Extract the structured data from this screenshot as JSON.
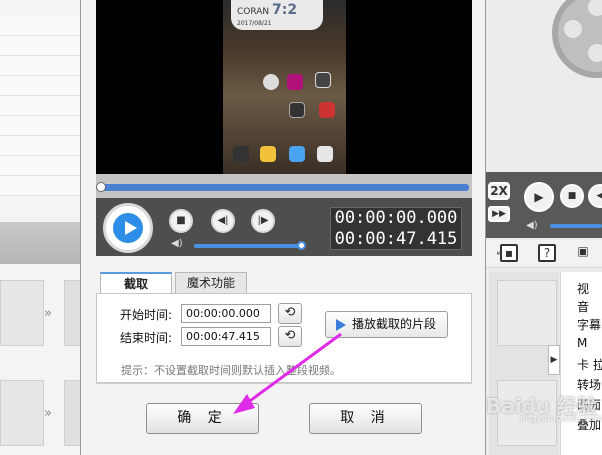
{
  "preview": {
    "phone_clock_brand": "CORAN",
    "phone_clock_time": "7:2",
    "phone_clock_date": "2017/08/21"
  },
  "player": {
    "time_start": "00:00:00.000",
    "time_total": "00:00:47.415",
    "position_fraction": 0.0,
    "volume_fraction": 1.0
  },
  "tabs": [
    {
      "label": "截取",
      "active": true
    },
    {
      "label": "魔术功能",
      "active": false
    }
  ],
  "clip": {
    "start_label": "开始时间:",
    "start_value": "00:00:00.000",
    "end_label": "结束时间:",
    "end_value": "00:00:47.415",
    "play_segment_label": "播放截取的片段",
    "hint": "提示：不设置截取时间则默认插入整段视频。"
  },
  "buttons": {
    "ok": "确 定",
    "cancel": "取 消"
  },
  "right_panel": {
    "speed_label": "2X",
    "lines": [
      "视",
      "音",
      "字幕",
      "M",
      "卡 拉",
      "转场",
      "画面",
      "叠加"
    ]
  },
  "watermark": {
    "text": "Baidu 经验",
    "sub": "jingyan.baidu.com"
  },
  "colors": {
    "accent_blue": "#2c8ee6",
    "timeline_blue": "#4a7fd1",
    "annotation_magenta": "#e02be6"
  }
}
